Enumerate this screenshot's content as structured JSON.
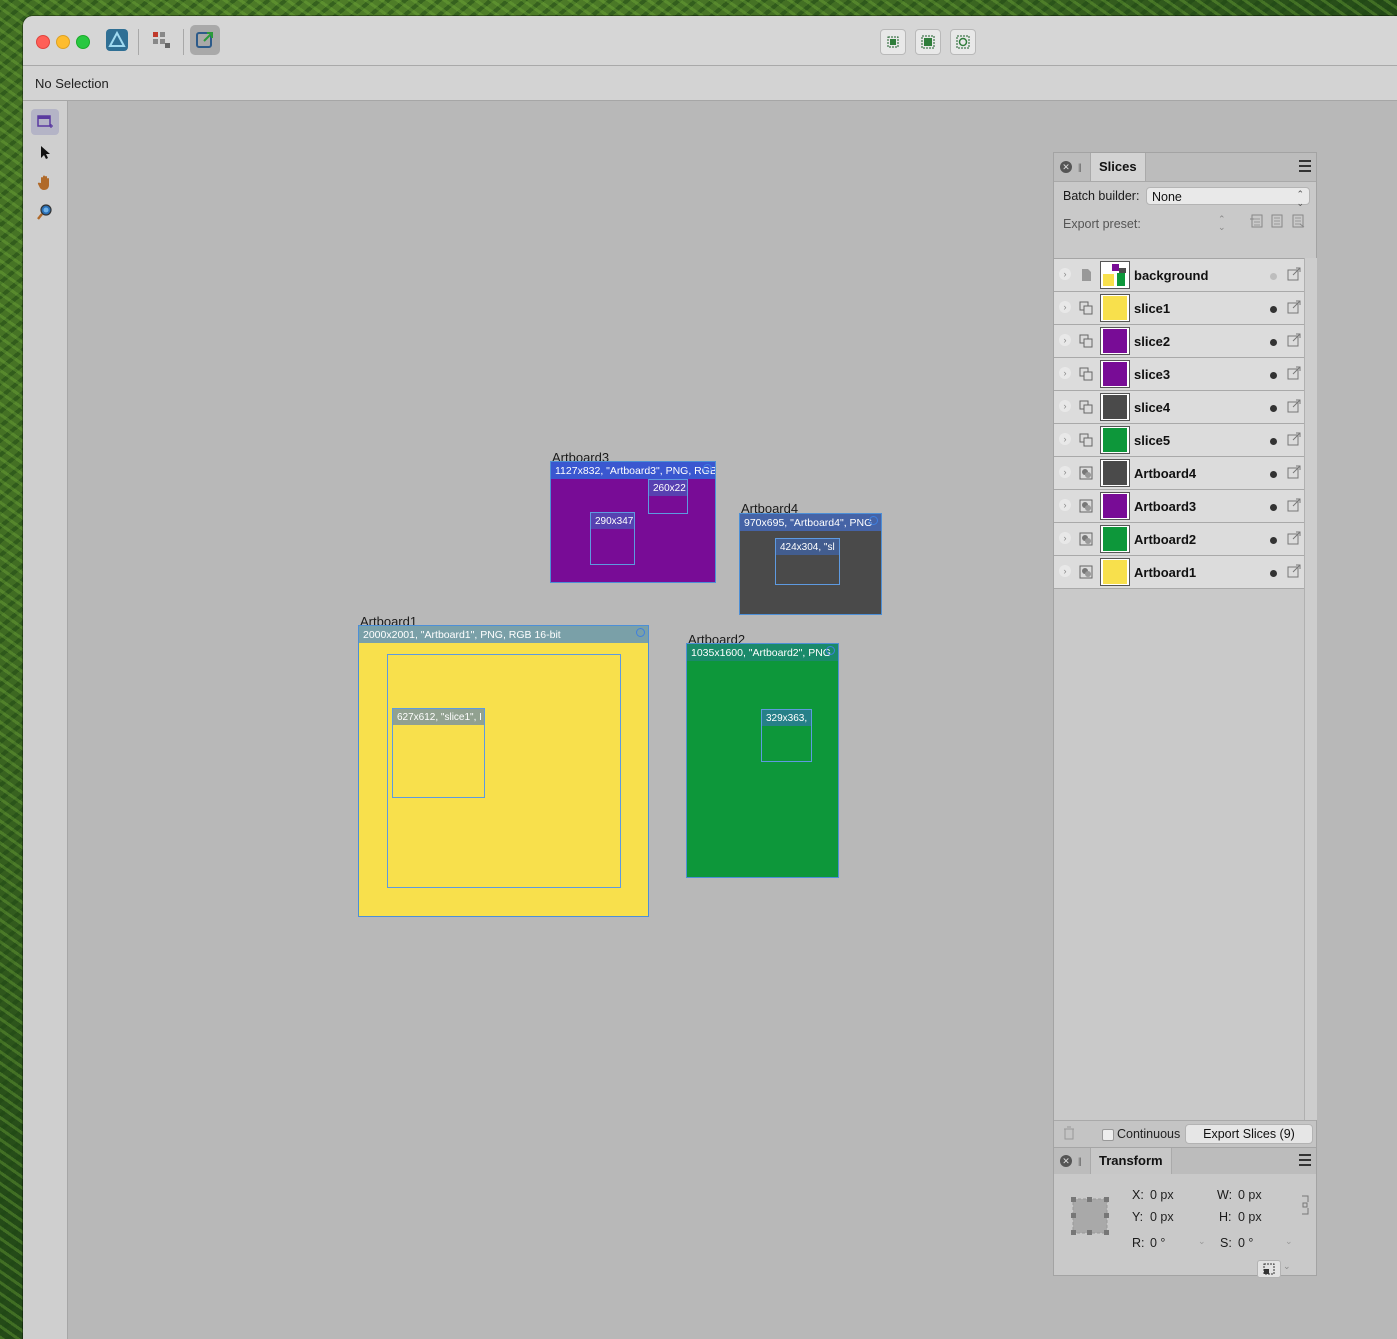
{
  "window": {
    "context_text": "No Selection"
  },
  "artboards": [
    {
      "label": "Artboard3",
      "bar": "1127x832, \"Artboard3\", PNG, RGB",
      "color": "#780c96",
      "slices": [
        {
          "text": "260x22"
        },
        {
          "text": "290x347"
        }
      ]
    },
    {
      "label": "Artboard4",
      "bar": "970x695, \"Artboard4\", PNG",
      "color": "#4a4a4a",
      "slices": [
        {
          "text": "424x304, \"sl"
        }
      ]
    },
    {
      "label": "Artboard1",
      "bar": "2000x2001, \"Artboard1\", PNG, RGB 16-bit",
      "color": "#f8e04c",
      "slices": [
        {
          "text": "627x612, \"slice1\", I"
        }
      ]
    },
    {
      "label": "Artboard2",
      "bar": "1035x1600, \"Artboard2\", PNG",
      "color": "#0d973a",
      "slices": [
        {
          "text": "329x363,"
        }
      ]
    }
  ],
  "slices_panel": {
    "tab_label": "Slices",
    "batch_label": "Batch builder:",
    "batch_value": "None",
    "preset_label": "Export preset:",
    "items": [
      {
        "name": "background",
        "kind": "document",
        "thumb": "multi"
      },
      {
        "name": "slice1",
        "kind": "slice",
        "thumb": "#f8e04c"
      },
      {
        "name": "slice2",
        "kind": "slice",
        "thumb": "#780c96"
      },
      {
        "name": "slice3",
        "kind": "slice",
        "thumb": "#780c96"
      },
      {
        "name": "slice4",
        "kind": "slice",
        "thumb": "#4a4a4a"
      },
      {
        "name": "slice5",
        "kind": "slice",
        "thumb": "#0d973a"
      },
      {
        "name": "Artboard4",
        "kind": "artboard",
        "thumb": "#4a4a4a"
      },
      {
        "name": "Artboard3",
        "kind": "artboard",
        "thumb": "#780c96"
      },
      {
        "name": "Artboard2",
        "kind": "artboard",
        "thumb": "#0d973a"
      },
      {
        "name": "Artboard1",
        "kind": "artboard",
        "thumb": "#f8e04c"
      }
    ],
    "continuous_label": "Continuous",
    "export_button": "Export Slices (9)"
  },
  "transform_panel": {
    "tab_label": "Transform",
    "x_label": "X:",
    "x_value": "0 px",
    "y_label": "Y:",
    "y_value": "0 px",
    "w_label": "W:",
    "w_value": "0 px",
    "h_label": "H:",
    "h_value": "0 px",
    "r_label": "R:",
    "r_value": "0 °",
    "s_label": "S:",
    "s_value": "0 °"
  }
}
